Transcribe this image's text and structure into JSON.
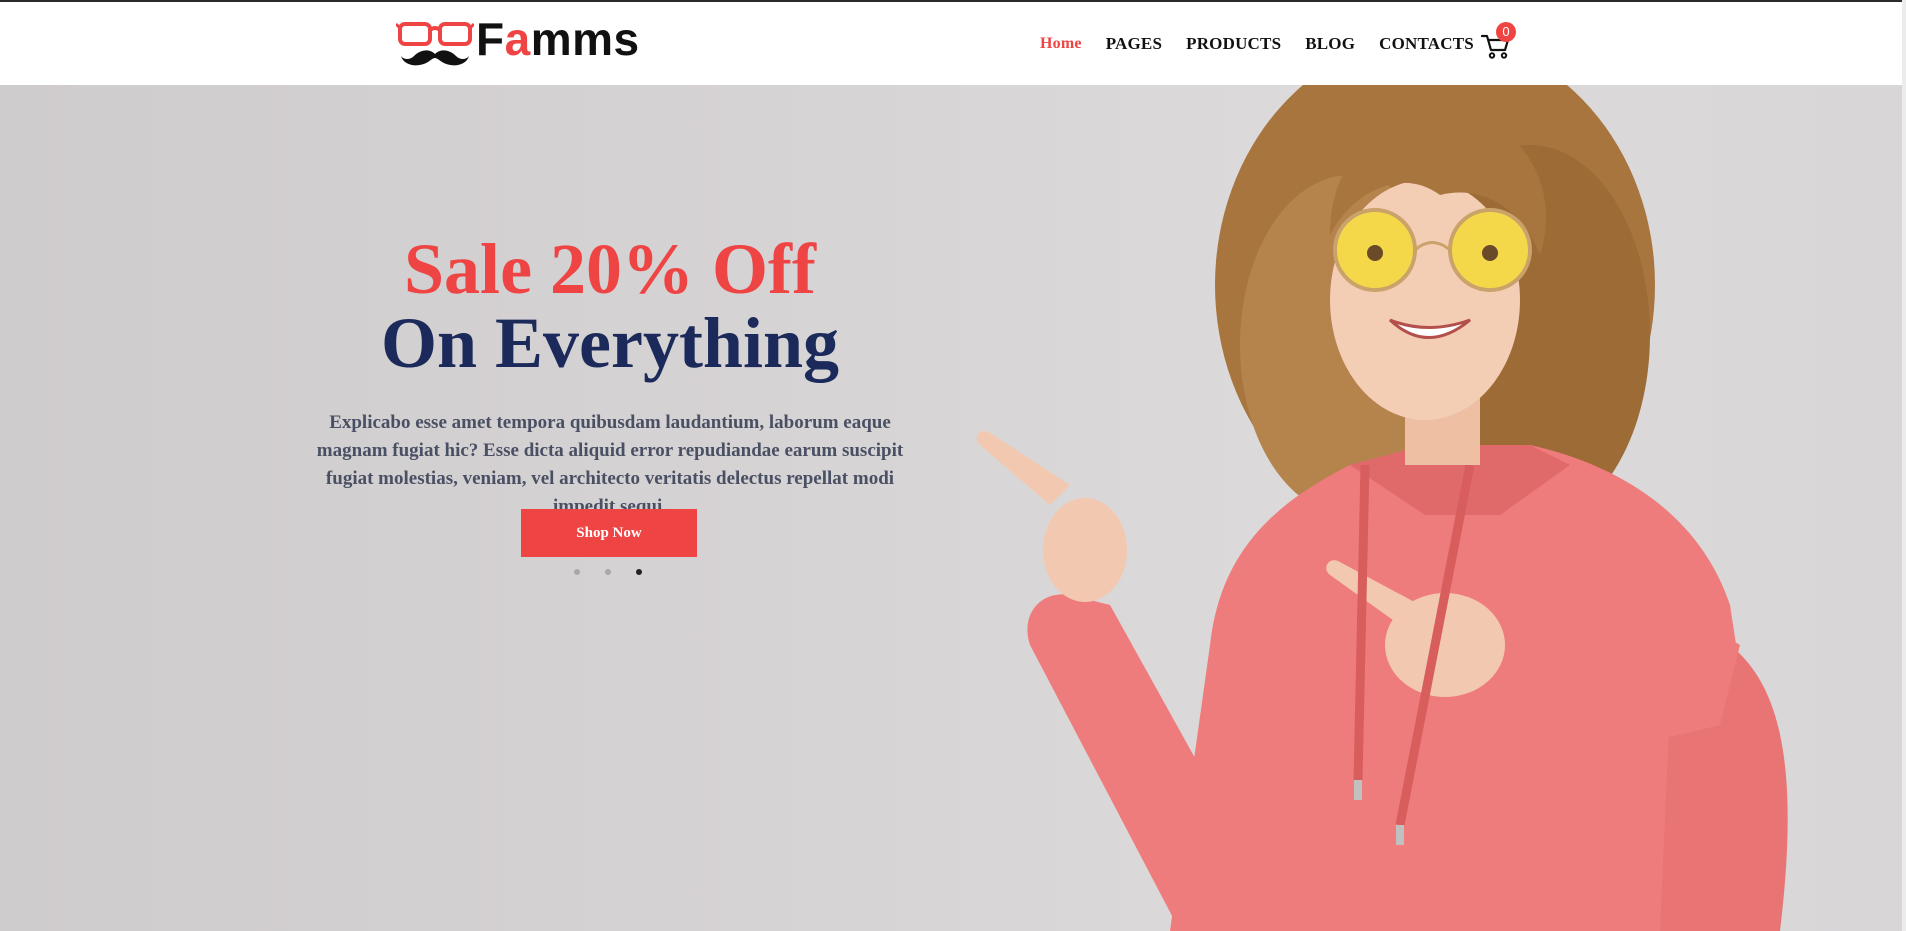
{
  "brand": {
    "name_prefix": "F",
    "name_accent": "a",
    "name_suffix": "mms",
    "accent_color": "#ef4444",
    "logo_icon": "glasses-mustache-icon"
  },
  "nav": {
    "items": [
      {
        "label": "Home",
        "active": true
      },
      {
        "label": "PAGES",
        "active": false
      },
      {
        "label": "PRODUCTS",
        "active": false
      },
      {
        "label": "BLOG",
        "active": false
      },
      {
        "label": "CONTACTS",
        "active": false
      }
    ],
    "cart_icon": "cart-icon",
    "cart_count": "0"
  },
  "hero": {
    "title_line1": "Sale 20% Off",
    "title_line2": "On Everything",
    "description": "Explicabo esse amet tempora quibusdam laudantium, laborum eaque magnam fugiat hic? Esse dicta aliquid error repudiandae earum suscipit fugiat molestias, veniam, vel architecto veritatis delectus repellat modi impedit sequi.",
    "cta_label": "Shop Now",
    "slides_total": 3,
    "active_slide": 3,
    "title_color_1": "#ef4444",
    "title_color_2": "#1b2a5a"
  }
}
